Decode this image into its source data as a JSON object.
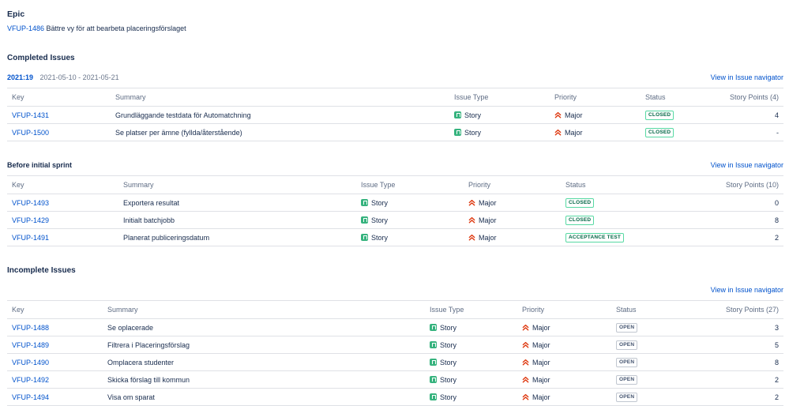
{
  "epic": {
    "heading": "Epic",
    "key": "VFUP-1486",
    "summary": "Bättre vy för att bearbeta placeringsförslaget"
  },
  "completed": {
    "heading": "Completed Issues",
    "sprint_id": "2021:19",
    "sprint_dates": "2021-05-10 - 2021-05-21",
    "nav_label": "View in Issue navigator",
    "columns": {
      "key": "Key",
      "summary": "Summary",
      "type": "Issue Type",
      "priority": "Priority",
      "status": "Status",
      "points": "Story Points (4)"
    },
    "rows": [
      {
        "key": "VFUP-1431",
        "summary": "Grundläggande testdata för Automatchning",
        "type": "Story",
        "priority": "Major",
        "status": "CLOSED",
        "points": "4"
      },
      {
        "key": "VFUP-1500",
        "summary": "Se platser per ämne (fyllda/återstående)",
        "type": "Story",
        "priority": "Major",
        "status": "CLOSED",
        "points": "-"
      }
    ]
  },
  "before_sprint": {
    "heading": "Before initial sprint",
    "nav_label": "View in Issue navigator",
    "columns": {
      "key": "Key",
      "summary": "Summary",
      "type": "Issue Type",
      "priority": "Priority",
      "status": "Status",
      "points": "Story Points (10)"
    },
    "rows": [
      {
        "key": "VFUP-1493",
        "summary": "Exportera resultat",
        "type": "Story",
        "priority": "Major",
        "status": "CLOSED",
        "points": "0"
      },
      {
        "key": "VFUP-1429",
        "summary": "Initialt batchjobb",
        "type": "Story",
        "priority": "Major",
        "status": "CLOSED",
        "points": "8"
      },
      {
        "key": "VFUP-1491",
        "summary": "Planerat publiceringsdatum",
        "type": "Story",
        "priority": "Major",
        "status": "ACCEPTANCE TEST",
        "points": "2"
      }
    ]
  },
  "incomplete": {
    "heading": "Incomplete Issues",
    "nav_label": "View in Issue navigator",
    "columns": {
      "key": "Key",
      "summary": "Summary",
      "type": "Issue Type",
      "priority": "Priority",
      "status": "Status",
      "points": "Story Points (27)"
    },
    "rows": [
      {
        "key": "VFUP-1488",
        "summary": "Se oplacerade",
        "type": "Story",
        "priority": "Major",
        "status": "OPEN",
        "points": "3"
      },
      {
        "key": "VFUP-1489",
        "summary": "Filtrera i Placeringsförslag",
        "type": "Story",
        "priority": "Major",
        "status": "OPEN",
        "points": "5"
      },
      {
        "key": "VFUP-1490",
        "summary": "Omplacera studenter",
        "type": "Story",
        "priority": "Major",
        "status": "OPEN",
        "points": "8"
      },
      {
        "key": "VFUP-1492",
        "summary": "Skicka förslag till kommun",
        "type": "Story",
        "priority": "Major",
        "status": "OPEN",
        "points": "2"
      },
      {
        "key": "VFUP-1494",
        "summary": "Visa om sparat",
        "type": "Story",
        "priority": "Major",
        "status": "OPEN",
        "points": "2"
      }
    ]
  },
  "icons": {
    "story": "story-icon",
    "priority_major": "priority-major-icon"
  },
  "colors": {
    "link": "#0052cc",
    "story_green": "#36b37e",
    "priority_red": "#de350b",
    "lozenge_green": "#006644",
    "lozenge_grey": "#42526e"
  }
}
